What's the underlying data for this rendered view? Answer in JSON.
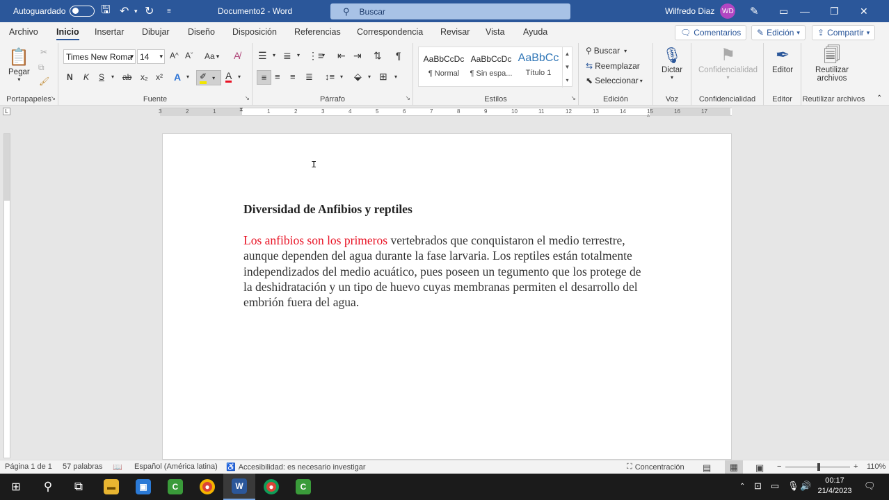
{
  "titlebar": {
    "autosave_label": "Autoguardado",
    "doc_title": "Documento2 - Word",
    "search_placeholder": "Buscar",
    "user_name": "Wilfredo Diaz",
    "user_initials": "WD"
  },
  "menu": {
    "tabs": [
      "Archivo",
      "Inicio",
      "Insertar",
      "Dibujar",
      "Diseño",
      "Disposición",
      "Referencias",
      "Correspondencia",
      "Revisar",
      "Vista",
      "Ayuda"
    ],
    "active_tab": "Inicio",
    "comments_label": "Comentarios",
    "editing_label": "Edición",
    "share_label": "Compartir"
  },
  "ribbon": {
    "clipboard": {
      "paste_label": "Pegar",
      "group_label": "Portapapeles"
    },
    "font": {
      "font_name": "Times New Roma",
      "font_size": "14",
      "bold": "N",
      "italic": "K",
      "underline": "S",
      "strike": "ab",
      "subscript": "x₂",
      "superscript": "x²",
      "case_label": "Aa",
      "group_label": "Fuente"
    },
    "paragraph": {
      "group_label": "Párrafo",
      "pilcrow": "¶"
    },
    "styles": {
      "group_label": "Estilos",
      "items": [
        {
          "preview": "AaBbCcDc",
          "name": "¶ Normal"
        },
        {
          "preview": "AaBbCcDc",
          "name": "¶ Sin espa..."
        },
        {
          "preview": "AaBbCc",
          "name": "Título 1"
        }
      ]
    },
    "editing": {
      "group_label": "Edición",
      "find": "Buscar",
      "replace": "Reemplazar",
      "select": "Seleccionar"
    },
    "voice": {
      "dictate": "Dictar",
      "group_label": "Voz"
    },
    "sensitivity": {
      "label": "Confidencialidad",
      "group_label": "Confidencialidad"
    },
    "editor": {
      "label": "Editor",
      "group_label": "Editor"
    },
    "reuse": {
      "label_line1": "Reutilizar",
      "label_line2": "archivos",
      "group_label": "Reutilizar archivos"
    }
  },
  "ruler": {
    "numbers": [
      "3",
      "2",
      "1",
      "1",
      "2",
      "3",
      "4",
      "5",
      "6",
      "7",
      "8",
      "9",
      "10",
      "11",
      "12",
      "13",
      "14",
      "15",
      "16",
      "17"
    ]
  },
  "document": {
    "heading": "Diversidad de Anfibios y reptiles",
    "highlighted_text": "Los anfibios son los primeros",
    "body_text": " vertebrados que conquistaron el medio terrestre, aunque dependen del agua durante la fase larvaria. Los reptiles están totalmente independizados del medio acuático, pues poseen un tegumento que los protege de la deshidratación y un tipo de huevo cuyas membranas permiten el desarrollo del embrión fuera del agua.",
    "highlight_color": "#e81123"
  },
  "status": {
    "page": "Página 1 de 1",
    "words": "57 palabras",
    "language": "Español (América latina)",
    "accessibility": "Accesibilidad: es necesario investigar",
    "focus": "Concentración",
    "zoom": "110%"
  },
  "taskbar": {
    "time": "00:17",
    "date": "21/4/2023"
  }
}
